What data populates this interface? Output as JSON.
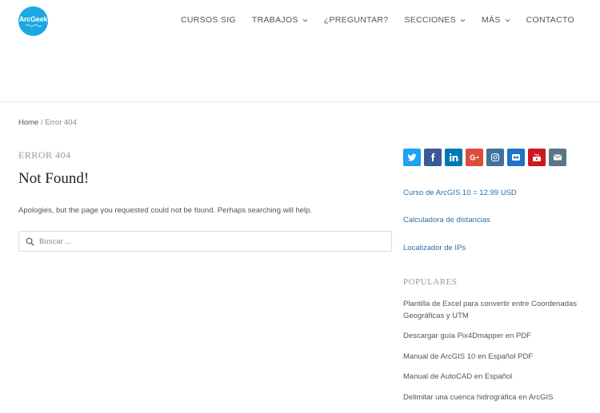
{
  "header": {
    "logo_text": "ArcGeek",
    "nav": [
      {
        "label": "CURSOS SIG",
        "dropdown": false
      },
      {
        "label": "TRABAJOS",
        "dropdown": true
      },
      {
        "label": "¿PREGUNTAR?",
        "dropdown": false
      },
      {
        "label": "SECCIONES",
        "dropdown": true
      },
      {
        "label": "MÁS",
        "dropdown": true
      },
      {
        "label": "CONTACTO",
        "dropdown": false
      }
    ]
  },
  "breadcrumb": {
    "home": "Home",
    "separator": " / ",
    "current": "Error 404"
  },
  "main": {
    "error_label": "ERROR 404",
    "title": "Not Found!",
    "message": "Apologies, but the page you requested could not be found. Perhaps searching will help.",
    "search_placeholder": "Buscar ..."
  },
  "sidebar": {
    "social": [
      {
        "name": "twitter-icon",
        "color": "#1da1f2"
      },
      {
        "name": "facebook-icon",
        "color": "#3b5998"
      },
      {
        "name": "linkedin-icon",
        "color": "#0077b5"
      },
      {
        "name": "google-plus-icon",
        "color": "#dd4b39"
      },
      {
        "name": "instagram-icon",
        "color": "#3f729b"
      },
      {
        "name": "flickr-icon",
        "color": "#1e73c8"
      },
      {
        "name": "youtube-icon",
        "color": "#cc181e"
      },
      {
        "name": "email-icon",
        "color": "#5a7684"
      }
    ],
    "links": [
      "Curso de ArcGIS 10 = 12.99 USD",
      "Calculadora de distancias",
      "Localizador de IPs"
    ],
    "populares_title": "POPULARES",
    "populares": [
      "Plantilla de Excel para convertir entre Coordenadas Geográficas y UTM",
      "Descargar guía Pix4Dmapper en PDF",
      "Manual de ArcGIS 10 en Español PDF",
      "Manual de AutoCAD en Español",
      "Delimitar una cuenca hidrográfica en ArcGIS"
    ]
  }
}
